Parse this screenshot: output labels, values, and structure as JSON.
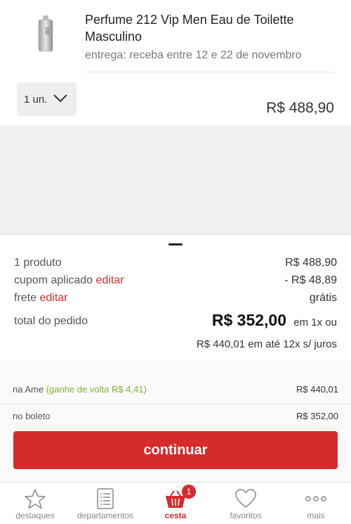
{
  "product": {
    "title": "Perfume 212 Vip Men Eau de Toilette Masculino",
    "shipping": "entrega: receba entre 12 e 22 de novembro",
    "quantity": "1 un.",
    "price": "R$ 488,90",
    "thumb_text": "212"
  },
  "summary": {
    "products_label": "1 produto",
    "products_value": "R$ 488,90",
    "coupon_label": "cupom aplicado",
    "coupon_edit": "editar",
    "coupon_value": "- R$ 48,89",
    "shipping_label": "frete",
    "shipping_edit": "editar",
    "shipping_value": "grátis",
    "total_label": "total do pedido",
    "total_value": "R$ 352,00",
    "total_suffix": "em 1x ou",
    "installment": "R$ 440,01 em até 12x s/ juros"
  },
  "payment": {
    "ame_label": "na Ame",
    "ame_cashback": "(ganhe de volta R$ 4,41)",
    "ame_value": "R$ 440,01",
    "boleto_label": "no boleto",
    "boleto_value": "R$ 352,00",
    "continue_label": "continuar"
  },
  "nav": {
    "items": [
      {
        "label": "destaques",
        "icon": "star-icon"
      },
      {
        "label": "departamentos",
        "icon": "list-icon"
      },
      {
        "label": "cesta",
        "icon": "basket-icon",
        "active": true,
        "badge": "1"
      },
      {
        "label": "favoritos",
        "icon": "heart-icon"
      },
      {
        "label": "mais",
        "icon": "more-icon"
      }
    ]
  },
  "colors": {
    "accent": "#d62b2b",
    "discount": "#7ab72e",
    "background": "#f1f1f1"
  }
}
